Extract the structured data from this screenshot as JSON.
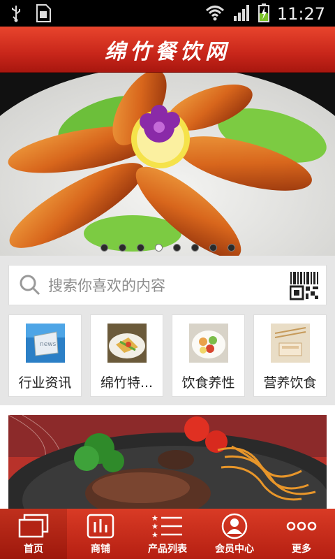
{
  "status_bar": {
    "time": "11:27"
  },
  "header": {
    "title": "绵竹餐饮网"
  },
  "banner": {
    "slide_count": 8,
    "active_index": 3
  },
  "search": {
    "placeholder": "搜索你喜欢的内容"
  },
  "categories": [
    {
      "label": "行业资讯",
      "icon": "news-icon"
    },
    {
      "label": "绵竹特...",
      "icon": "food-photo-icon"
    },
    {
      "label": "饮食养性",
      "icon": "food-photo-icon"
    },
    {
      "label": "营养饮食",
      "icon": "food-photo-icon"
    }
  ],
  "tabbar": {
    "items": [
      {
        "label": "首页",
        "icon": "home-icon"
      },
      {
        "label": "商铺",
        "icon": "shop-icon"
      },
      {
        "label": "产品列表",
        "icon": "list-icon"
      },
      {
        "label": "会员中心",
        "icon": "member-icon"
      },
      {
        "label": "更多",
        "icon": "more-icon"
      }
    ],
    "active": "首页"
  },
  "colors": {
    "brand_red": "#c8261a",
    "tab_red": "#b51f12"
  }
}
